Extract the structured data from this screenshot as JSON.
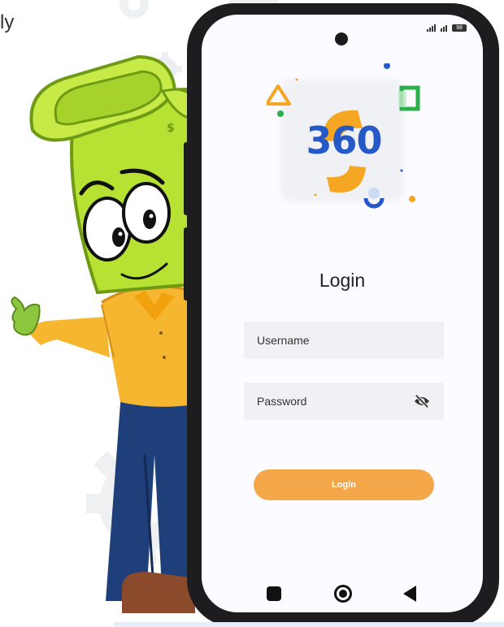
{
  "background": {
    "text_fragment": "ly"
  },
  "status_bar": {
    "battery": "98"
  },
  "logo": {
    "text": "360"
  },
  "login": {
    "title": "Login",
    "username_placeholder": "Username",
    "password_placeholder": "Password",
    "button_label": "Login"
  },
  "icons": {
    "password_toggle": "eye-off-icon",
    "nav_recents": "square-icon",
    "nav_home": "circle-icon",
    "nav_back": "triangle-back-icon",
    "camera": "camera-dot-icon"
  },
  "colors": {
    "accent": "#f4a748",
    "logo_blue": "#2659c8",
    "logo_orange": "#f5a623",
    "logo_green": "#2bb04a",
    "phone_frame": "#1d1d1f",
    "screen_bg": "#fcfbff",
    "field_bg": "#f1f0f4",
    "mascot_green": "#b7e233",
    "shirt_yellow": "#f6b630",
    "pants_blue": "#1f3f7a"
  }
}
